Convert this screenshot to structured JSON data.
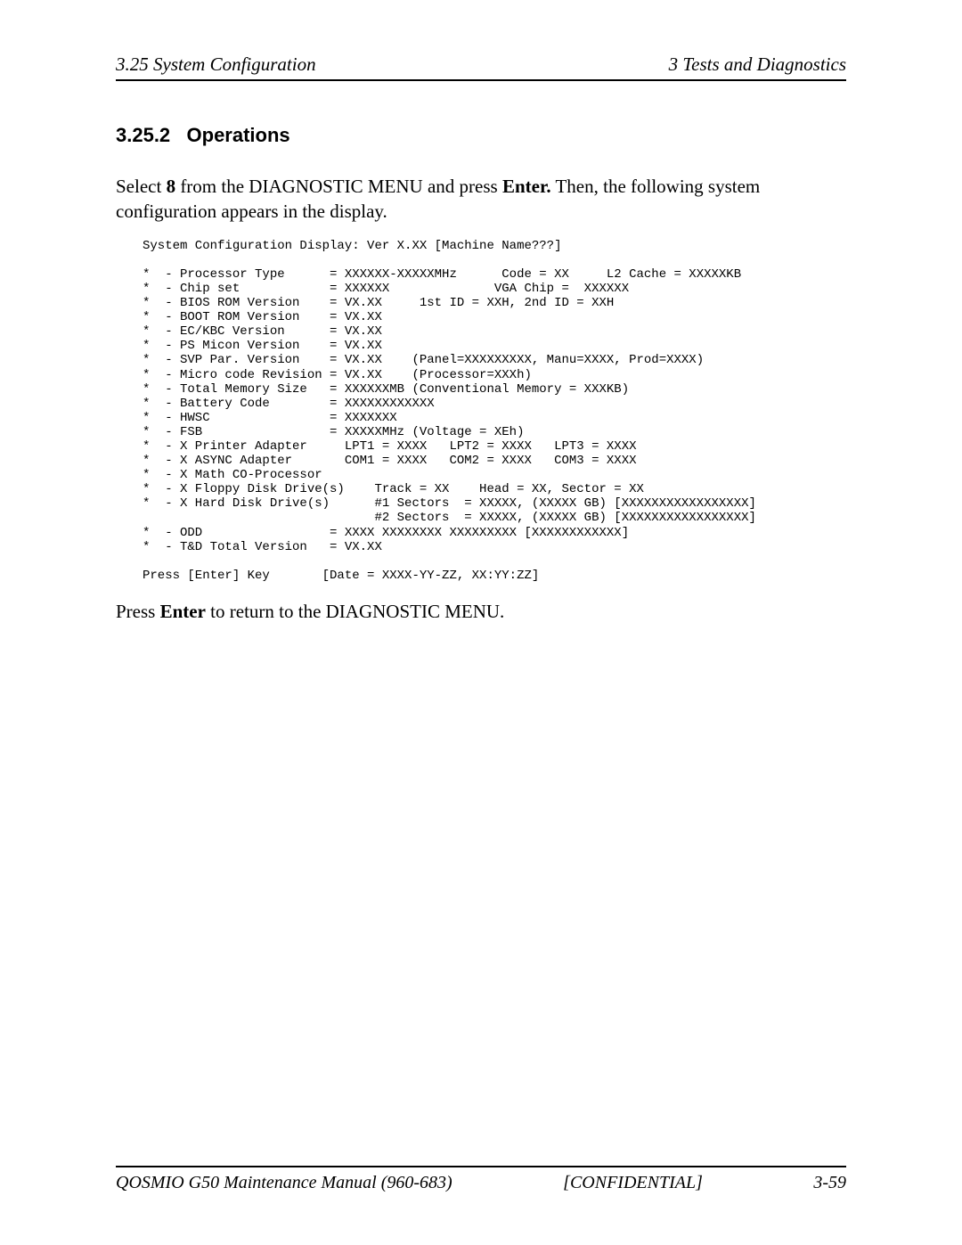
{
  "header": {
    "left": "3.25 System Configuration",
    "right": "3  Tests and Diagnostics"
  },
  "section": {
    "number": "3.25.2",
    "title": "Operations"
  },
  "intro": {
    "pre": "Select ",
    "key1": "8",
    "mid1": " from the DIAGNOSTIC MENU and press ",
    "key2": "Enter.",
    "post": " Then, the following system configuration appears in the display."
  },
  "config_text": "System Configuration Display: Ver X.XX [Machine Name???]\n\n*  - Processor Type      = XXXXXX-XXXXXMHz      Code = XX     L2 Cache = XXXXXKB\n*  - Chip set            = XXXXXX              VGA Chip =  XXXXXX\n*  - BIOS ROM Version    = VX.XX     1st ID = XXH, 2nd ID = XXH\n*  - BOOT ROM Version    = VX.XX\n*  - EC/KBC Version      = VX.XX\n*  - PS Micon Version    = VX.XX\n*  - SVP Par. Version    = VX.XX    (Panel=XXXXXXXXX, Manu=XXXX, Prod=XXXX)\n*  - Micro code Revision = VX.XX    (Processor=XXXh)\n*  - Total Memory Size   = XXXXXXMB (Conventional Memory = XXXKB)\n*  - Battery Code        = XXXXXXXXXXXX\n*  - HWSC                = XXXXXXX\n*  - FSB                 = XXXXXMHz (Voltage = XEh)\n*  - X Printer Adapter     LPT1 = XXXX   LPT2 = XXXX   LPT3 = XXXX\n*  - X ASYNC Adapter       COM1 = XXXX   COM2 = XXXX   COM3 = XXXX\n*  - X Math CO-Processor\n*  - X Floppy Disk Drive(s)    Track = XX    Head = XX, Sector = XX\n*  - X Hard Disk Drive(s)      #1 Sectors  = XXXXX, (XXXXX GB) [XXXXXXXXXXXXXXXXX]\n                               #2 Sectors  = XXXXX, (XXXXX GB) [XXXXXXXXXXXXXXXXX]\n*  - ODD                 = XXXX XXXXXXXX XXXXXXXXX [XXXXXXXXXXXX]\n*  - T&D Total Version   = VX.XX\n\nPress [Enter] Key       [Date = XXXX-YY-ZZ, XX:YY:ZZ]",
  "outro": {
    "pre": "Press ",
    "key": "Enter",
    "post": " to return to the DIAGNOSTIC MENU."
  },
  "footer": {
    "left": "QOSMIO G50 Maintenance Manual (960-683)",
    "center": "[CONFIDENTIAL]",
    "right": "3-59"
  }
}
